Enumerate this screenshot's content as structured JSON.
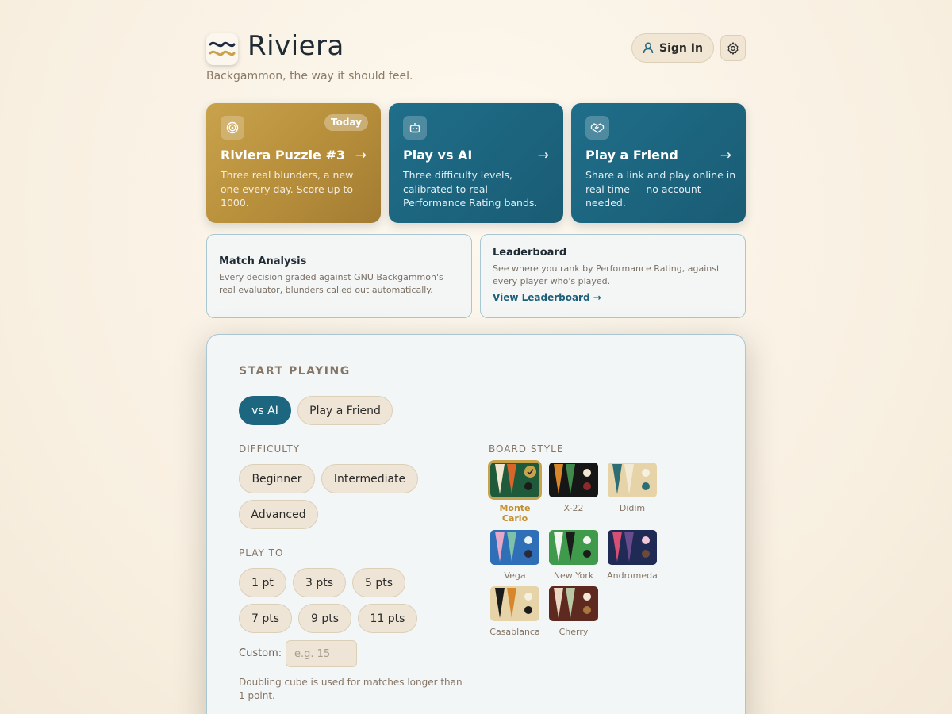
{
  "header": {
    "app_title": "Riviera",
    "tagline": "Backgammon, the way it should feel.",
    "sign_in_label": "Sign In"
  },
  "feature_cards": [
    {
      "title": "Riviera Puzzle #3",
      "badge": "Today",
      "arrow": "→",
      "description": "Three real blunders, a new one every day. Score up to 1000.",
      "icon": "target-icon"
    },
    {
      "title": "Play vs AI",
      "arrow": "→",
      "description": "Three difficulty levels, calibrated to real Performance Rating bands.",
      "icon": "robot-icon"
    },
    {
      "title": "Play a Friend",
      "arrow": "→",
      "description": "Share a link and play online in real time — no account needed.",
      "icon": "handshake-icon"
    }
  ],
  "secondary_cards": [
    {
      "title": "Match Analysis",
      "description": "Every decision graded against GNU Backgammon's real evaluator, blunders called out automatically."
    },
    {
      "title": "Leaderboard",
      "description": "See where you rank by Performance Rating, against every player who's played.",
      "link": "View Leaderboard →"
    }
  ],
  "start_playing": {
    "heading": "START PLAYING",
    "mode_tabs": [
      "vs AI",
      "Play a Friend"
    ],
    "active_mode": "vs AI",
    "difficulty_label": "DIFFICULTY",
    "difficulty_options": [
      "Beginner",
      "Intermediate",
      "Advanced"
    ],
    "play_to_label": "PLAY TO",
    "play_to_options": [
      "1 pt",
      "3 pts",
      "5 pts",
      "7 pts",
      "9 pts",
      "11 pts"
    ],
    "custom_label": "Custom:",
    "custom_placeholder": "e.g. 15",
    "note": "Doubling cube is used for matches longer than 1 point.",
    "board_style_label": "BOARD STYLE",
    "board_styles": [
      {
        "name": "Monte Carlo",
        "line1": "Monte",
        "line2": "Carlo",
        "selected": true,
        "bg": "#1f5a3a",
        "t1": "#f1e6d0",
        "t2": "#d9652b",
        "d1": "#f1e6d0",
        "d2": "#1b1b1b"
      },
      {
        "name": "X-22",
        "bg": "#161616",
        "t1": "#d8862a",
        "t2": "#3f8a4a",
        "d1": "#f1e6d0",
        "d2": "#8a2a2a"
      },
      {
        "name": "Didim",
        "bg": "#e6d3a8",
        "t1": "#2d6e74",
        "t2": "#f3ead6",
        "d1": "#f6f0e2",
        "d2": "#2d6e74"
      },
      {
        "name": "Vega",
        "bg": "#2f6fb8",
        "t1": "#e7a8c8",
        "t2": "#7ec0a8",
        "d1": "#e9f3f6",
        "d2": "#2a2a3a"
      },
      {
        "name": "New York",
        "bg": "#3f9a4c",
        "t1": "#f3f3ef",
        "t2": "#1b1b1b",
        "d1": "#f3f3ef",
        "d2": "#1b1b1b"
      },
      {
        "name": "Andromeda",
        "bg": "#1f2a55",
        "t1": "#d84f74",
        "t2": "#6a4c8e",
        "d1": "#f0c8d8",
        "d2": "#6b4a3a"
      },
      {
        "name": "Casablanca",
        "bg": "#e6d3a8",
        "t1": "#1b1b1b",
        "t2": "#d8862a",
        "d1": "#f6f0e2",
        "d2": "#1b1b1b"
      },
      {
        "name": "Cherry",
        "bg": "#5e2a1f",
        "t1": "#ead8c4",
        "t2": "#b8c8a4",
        "d1": "#f3e6d6",
        "d2": "#a8783f"
      }
    ]
  },
  "colors": {
    "accent": "#1d6680",
    "gold": "#c9a24c",
    "background": "#fbf4e8"
  }
}
